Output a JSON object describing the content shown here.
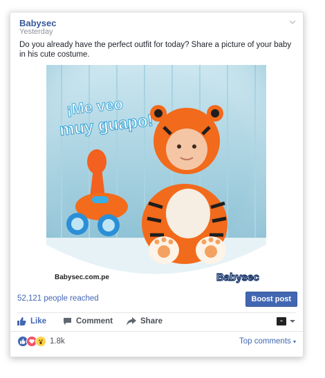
{
  "post": {
    "page_name": "Babysec",
    "timestamp": "Yesterday",
    "text": "Do you already have the perfect outfit for today? Share a picture of your baby in his cute costume."
  },
  "photo": {
    "headline_line1": "¡Me veo",
    "headline_line2": "muy guapo!",
    "website": "Babysec.com.pe",
    "brand_logo": "Babysec",
    "description": "Baby in tiger costume sitting next to a toy horse"
  },
  "stats": {
    "reach": "52,121 people reached",
    "boost_label": "Boost post"
  },
  "actions": {
    "like": "Like",
    "comment": "Comment",
    "share": "Share"
  },
  "reactions": {
    "count": "1.8k",
    "icons": [
      "like-icon",
      "love-icon",
      "wow-icon"
    ],
    "top_comments": "Top comments"
  },
  "colors": {
    "link": "#4267b2",
    "boost_bg": "#4267b2",
    "muted": "#90949c"
  }
}
